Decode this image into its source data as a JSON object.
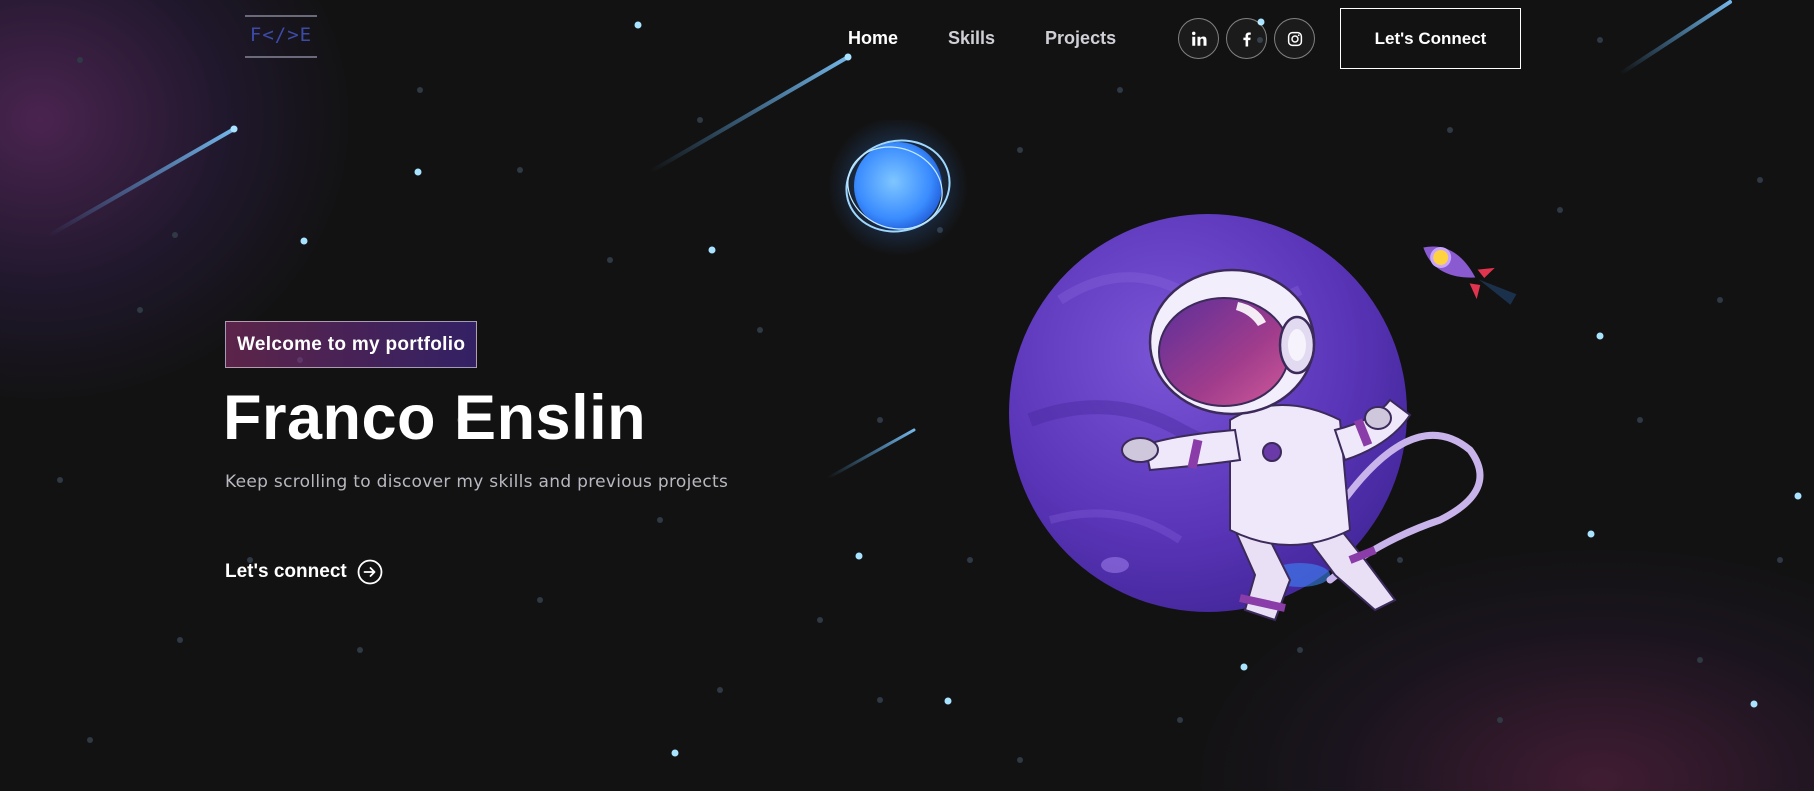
{
  "logo": {
    "text": "F</>E"
  },
  "nav": {
    "links": [
      {
        "label": "Home",
        "active": true
      },
      {
        "label": "Skills",
        "active": false
      },
      {
        "label": "Projects",
        "active": false
      }
    ],
    "social": [
      "linkedin-icon",
      "facebook-icon",
      "instagram-icon"
    ],
    "connect_label": "Let's Connect"
  },
  "hero": {
    "tagline": "Welcome to my portfolio",
    "title": "Franco Enslin",
    "subtitle": "Keep scrolling to discover my skills and previous projects",
    "cta_label": "Let's connect",
    "cta_icon": "arrow-circle-right-icon"
  },
  "colors": {
    "background": "#121212",
    "tagline_gradient_start": "#aa367c",
    "tagline_gradient_end": "#4a2fbd",
    "planet": "#6a3fc2",
    "orb": "#4aa8ff"
  }
}
